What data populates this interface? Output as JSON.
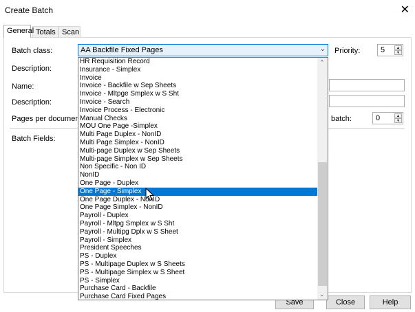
{
  "window": {
    "title": "Create Batch"
  },
  "tabs": [
    "General",
    "Totals",
    "Scan"
  ],
  "form": {
    "batch_class_label": "Batch class:",
    "batch_class_value": "AA Backfile Fixed Pages",
    "priority_label": "Priority:",
    "priority_value": "5",
    "description_label": "Description:",
    "name_label": "Name:",
    "description2_label": "Description:",
    "pages_label": "Pages per document:",
    "batch_label": "batch:",
    "batch_value": "0",
    "batch_fields_label": "Batch Fields:"
  },
  "dropdown": {
    "items": [
      "HR Requisition Record",
      "Insurance - Simplex",
      "Invoice",
      "Invoice - Backfile w Sep Sheets",
      "Invoice - Mltpge Smplex w S Sht",
      "Invoice - Search",
      "Invoice Process - Electronic",
      "Manual Checks",
      "MOU One Page -Simplex",
      "Multi Page Duplex - NonID",
      "Multi Page Simplex - NonID",
      "Multi-page Duplex w Sep Sheets",
      "Multi-page Simplex w Sep Sheets",
      "Non Specific - Non ID",
      "NonID",
      "One Page - Duplex",
      "One Page - Simplex",
      "One Page Duplex - NonID",
      "One Page Simplex - NonID",
      "Payroll - Duplex",
      "Payroll - Mltpg Smplex w S Sht",
      "Payroll - Multipg Dplx w S Sheet",
      "Payroll - Simplex",
      "President Speeches",
      "PS - Duplex",
      "PS - Multipage Duplex w S Sheets",
      "PS - Multipage Simplex w S Sheet",
      "PS - Simplex",
      "Purchase Card - Backfile",
      "Purchase Card Fixed Pages"
    ],
    "selected_index": 16
  },
  "buttons": {
    "save": "Save",
    "close": "Close",
    "help": "Help"
  },
  "colors": {
    "selection": "#0078d7",
    "focus_border": "#0078d7"
  }
}
